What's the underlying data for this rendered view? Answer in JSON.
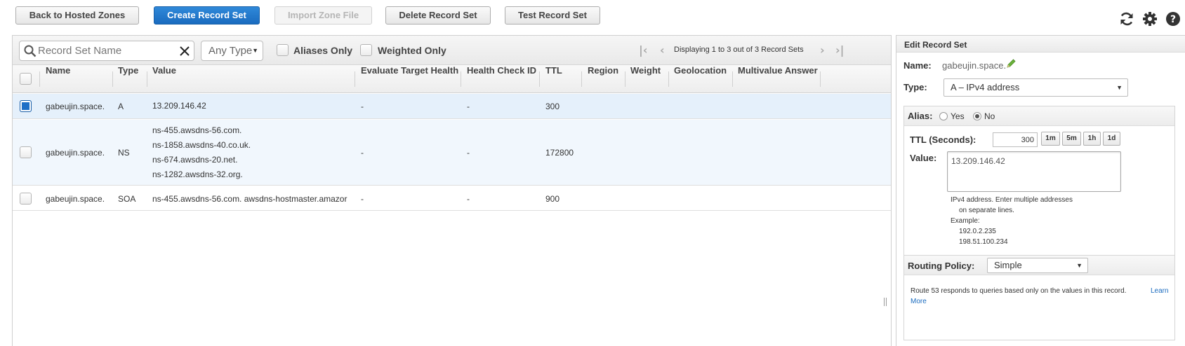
{
  "toolbar": {
    "back": "Back to Hosted Zones",
    "create": "Create Record Set",
    "import": "Import Zone File",
    "delete": "Delete Record Set",
    "test": "Test Record Set"
  },
  "top_icons": [
    "refresh-icon",
    "gear-icon",
    "help-icon"
  ],
  "filter": {
    "search_placeholder": "Record Set Name",
    "type_value": "Any Type",
    "aliases_only": "Aliases Only",
    "weighted_only": "Weighted Only",
    "pager_text": "Displaying 1 to 3 out of 3 Record Sets"
  },
  "table": {
    "headers": [
      "Name",
      "Type",
      "Value",
      "Evaluate Target Health",
      "Health Check ID",
      "TTL",
      "Region",
      "Weight",
      "Geolocation",
      "Multivalue Answer"
    ],
    "rows": [
      {
        "name": "gabeujin.space.",
        "type": "A",
        "value": [
          "13.209.146.42"
        ],
        "eval": "-",
        "hc": "-",
        "ttl": "300",
        "selected": true
      },
      {
        "name": "gabeujin.space.",
        "type": "NS",
        "value": [
          "ns-455.awsdns-56.com.",
          "ns-1858.awsdns-40.co.uk.",
          "ns-674.awsdns-20.net.",
          "ns-1282.awsdns-32.org."
        ],
        "eval": "-",
        "hc": "-",
        "ttl": "172800",
        "selected": false
      },
      {
        "name": "gabeujin.space.",
        "type": "SOA",
        "value": [
          "ns-455.awsdns-56.com. awsdns-hostmaster.amazor"
        ],
        "eval": "-",
        "hc": "-",
        "ttl": "900",
        "selected": false
      }
    ]
  },
  "edit": {
    "title": "Edit Record Set",
    "name_label": "Name:",
    "name_value": "gabeujin.space.",
    "type_label": "Type:",
    "type_value": "A – IPv4 address",
    "alias_label": "Alias:",
    "alias_yes": "Yes",
    "alias_no": "No",
    "alias_selected": "No",
    "ttl_label": "TTL (Seconds):",
    "ttl_value": "300",
    "ttl_buttons": [
      "1m",
      "5m",
      "1h",
      "1d"
    ],
    "value_label": "Value:",
    "value_text": "13.209.146.42",
    "help_lines": [
      "IPv4 address. Enter multiple addresses",
      "on separate lines.",
      "Example:",
      "192.0.2.235",
      "198.51.100.234"
    ],
    "routing_label": "Routing Policy:",
    "routing_value": "Simple",
    "routing_help": "Route 53 responds to queries based only on the values in this record.",
    "learn": "Learn",
    "more": "More"
  },
  "colors": {
    "primary_button": "#2f89d9",
    "selected_row": "#e5f0fb",
    "link": "#1a6bbf",
    "edit_icon": "#6bb33a"
  }
}
